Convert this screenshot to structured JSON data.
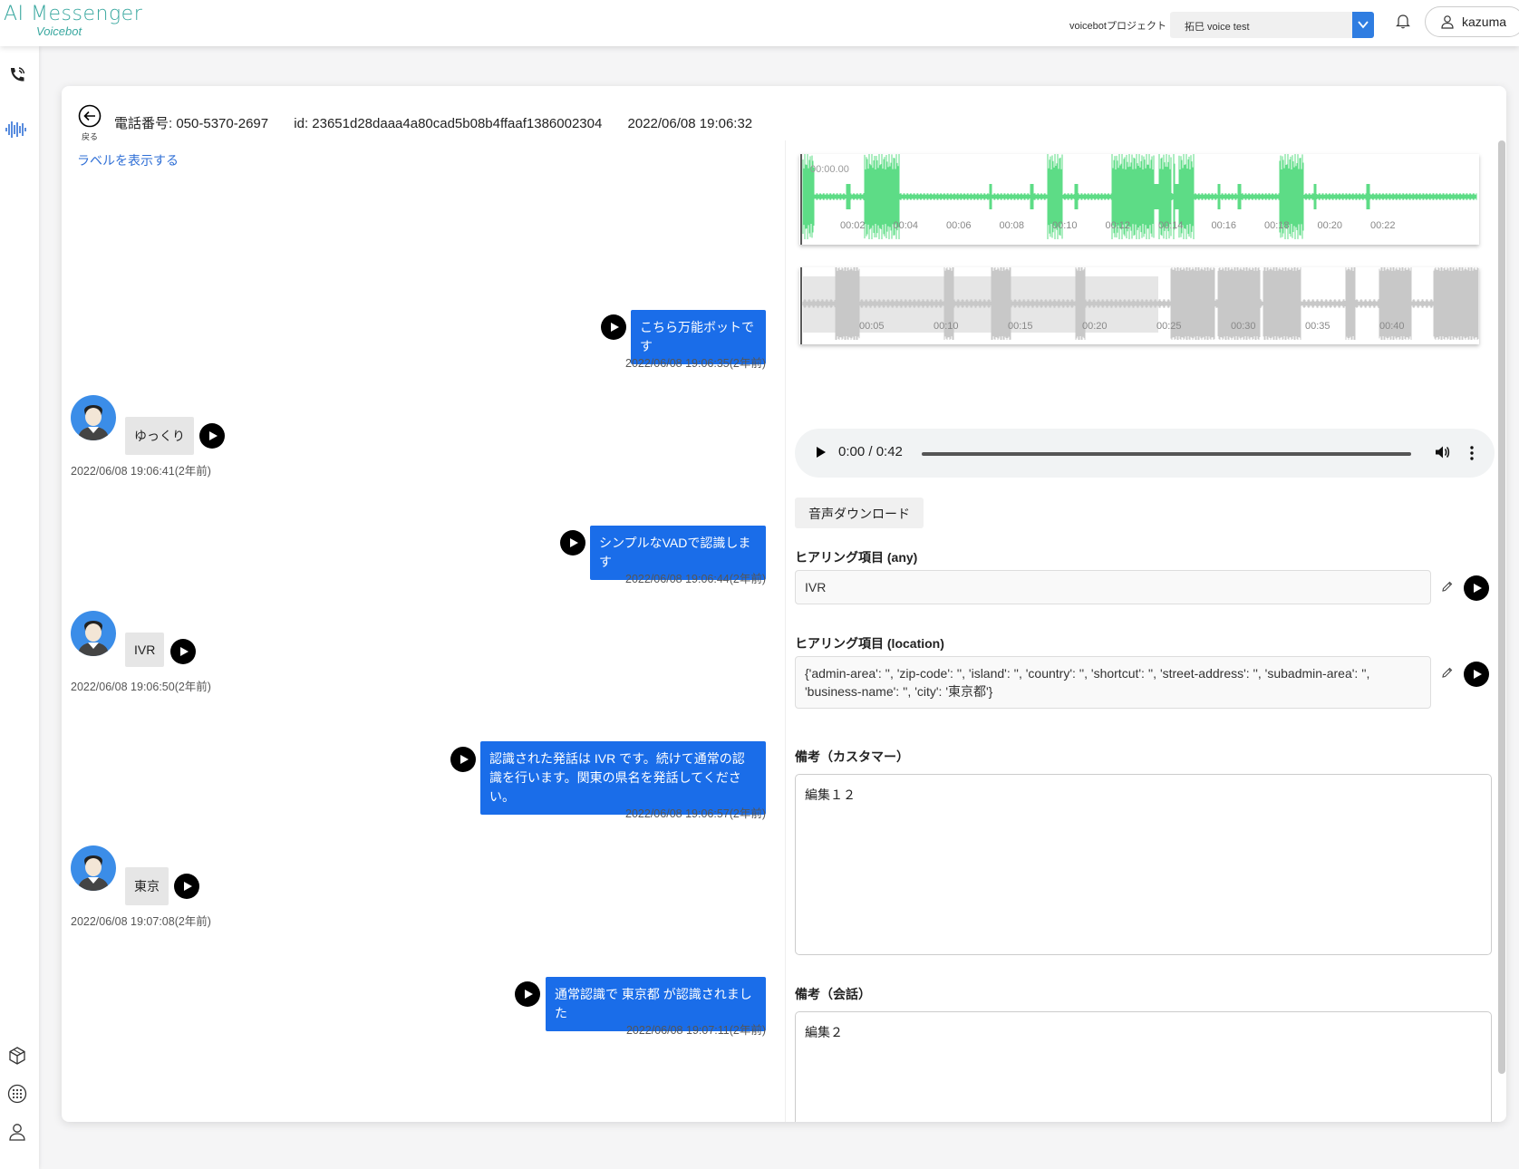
{
  "header": {
    "logo_title": "AI Messenger",
    "logo_sub": "Voicebot",
    "project_label": "voicebotプロジェクト",
    "project_selected": "拓巳 voice test",
    "user_name": "kazuma"
  },
  "call": {
    "back_label": "戻る",
    "phone": "電話番号: 050-5370-2697",
    "id": "id: 23651d28daaa4a80cad5b08b4ffaaf1386002304",
    "datetime": "2022/06/08 19:06:32",
    "show_labels": "ラベルを表示する"
  },
  "messages": [
    {
      "role": "bot",
      "text": "こちら万能ボットです",
      "ts": "2022/06/08 19:06:35(2年前)"
    },
    {
      "role": "user",
      "text": "ゆっくり",
      "ts": "2022/06/08 19:06:41(2年前)"
    },
    {
      "role": "bot",
      "text": "シンプルなVADで認識します",
      "ts": "2022/06/08 19:06:44(2年前)"
    },
    {
      "role": "user",
      "text": "IVR",
      "ts": "2022/06/08 19:06:50(2年前)"
    },
    {
      "role": "bot",
      "text": "認識された発話は IVR です。続けて通常の認識を行います。関東の県名を発話してください。",
      "ts": "2022/06/08 19:06:57(2年前)"
    },
    {
      "role": "user",
      "text": "東京",
      "ts": "2022/06/08 19:07:08(2年前)"
    },
    {
      "role": "bot",
      "text": "通常認識で 東京都 が認識されました",
      "ts": "2022/06/08 19:07:11(2年前)"
    }
  ],
  "waveform": {
    "top_start_label": "00:00.00",
    "top_ticks": [
      "00:02",
      "00:04",
      "00:06",
      "00:08",
      "00:10",
      "00:12",
      "00:14",
      "00:16",
      "00:18",
      "00:20",
      "00:22"
    ],
    "bottom_ticks": [
      "00:05",
      "00:10",
      "00:15",
      "00:20",
      "00:25",
      "00:30",
      "00:35",
      "00:40"
    ],
    "top_color": "#5ddc86",
    "bottom_color": "#c8c8c8"
  },
  "player": {
    "time": "0:00 / 0:42"
  },
  "download_label": "音声ダウンロード",
  "fields": {
    "any_label": "ヒアリング項目 (any)",
    "any_value": "IVR",
    "location_label": "ヒアリング項目 (location)",
    "location_value": "{'admin-area': '', 'zip-code': '', 'island': '', 'country': '', 'shortcut': '', 'street-address': '', 'subadmin-area': '', 'business-name': '', 'city': '東京都'}",
    "customer_note_label": "備考（カスタマー）",
    "customer_note_value": "編集１２",
    "conversation_note_label": "備考（会話）",
    "conversation_note_value": "編集２"
  },
  "colors": {
    "accent": "#1a6de9",
    "link": "#2f6fd6",
    "logo": "#3aa8a0"
  }
}
